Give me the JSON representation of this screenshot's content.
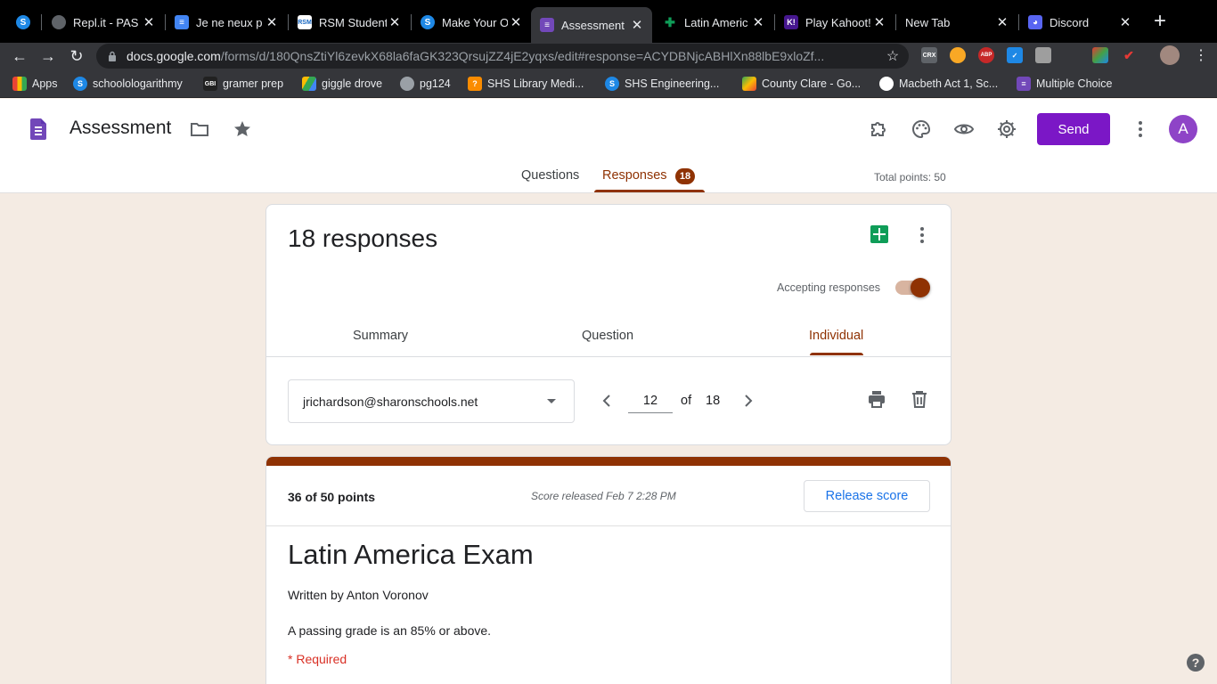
{
  "browser": {
    "tabs": [
      {
        "title": "",
        "icon": "s-circle-icon"
      },
      {
        "title": "Repl.it - PAS",
        "icon": "replit-icon"
      },
      {
        "title": "Je ne neux p",
        "icon": "docs-icon"
      },
      {
        "title": "RSM Student",
        "icon": "rsm-icon"
      },
      {
        "title": "Make Your O",
        "icon": "s-circle-icon"
      },
      {
        "title": "Assessment",
        "icon": "forms-icon"
      },
      {
        "title": "Latin Americ",
        "icon": "green-cross-icon"
      },
      {
        "title": "Play Kahoot!",
        "icon": "kahoot-icon"
      },
      {
        "title": "New Tab",
        "icon": ""
      },
      {
        "title": "Discord",
        "icon": "discord-icon"
      }
    ],
    "url_host": "docs.google.com",
    "url_path": "/forms/d/180QnsZtiYl6zevkX68la6faGK323QrsujZZ4jE2yqxs/edit#response=ACYDBNjcABHlXn88lbE9xloZf...",
    "extensions": [
      "CRX",
      "ABP"
    ],
    "bookmarks": [
      {
        "label": "Apps",
        "icon": "apps-grid-icon"
      },
      {
        "label": "schoolologarithmy",
        "icon": "s-circle-icon"
      },
      {
        "label": "gramer prep",
        "icon": "gbi-icon"
      },
      {
        "label": "giggle drove",
        "icon": "drive-icon"
      },
      {
        "label": "pg124",
        "icon": "globe-icon"
      },
      {
        "label": "SHS Library Medi...",
        "icon": "library-icon"
      },
      {
        "label": "SHS Engineering...",
        "icon": "s-circle-icon"
      },
      {
        "label": "County Clare - Go...",
        "icon": "maps-icon"
      },
      {
        "label": "Macbeth Act 1, Sc...",
        "icon": "quiz-icon"
      },
      {
        "label": "Multiple Choice",
        "icon": "forms-icon"
      }
    ]
  },
  "header": {
    "title": "Assessment",
    "send_label": "Send",
    "avatar_letter": "A",
    "tabs": {
      "questions": "Questions",
      "responses": "Responses",
      "responses_count": "18"
    },
    "total_points": "Total points: 50"
  },
  "responses": {
    "count_title": "18 responses",
    "accepting_label": "Accepting responses",
    "accepting": true,
    "subtabs": {
      "summary": "Summary",
      "question": "Question",
      "individual": "Individual"
    },
    "respondent": "jrichardson@sharonschools.net",
    "current": "12",
    "of": "of",
    "total": "18"
  },
  "form": {
    "score": "36 of 50 points",
    "score_released": "Score released Feb 7 2:28 PM",
    "release_label": "Release score",
    "title": "Latin America Exam",
    "author": "Written by Anton Voronov",
    "description": "A passing grade is an 85% or above.",
    "required": "* Required"
  },
  "colors": {
    "accent": "#8f3203",
    "send": "#7b17c6",
    "forms": "#7248b9"
  }
}
